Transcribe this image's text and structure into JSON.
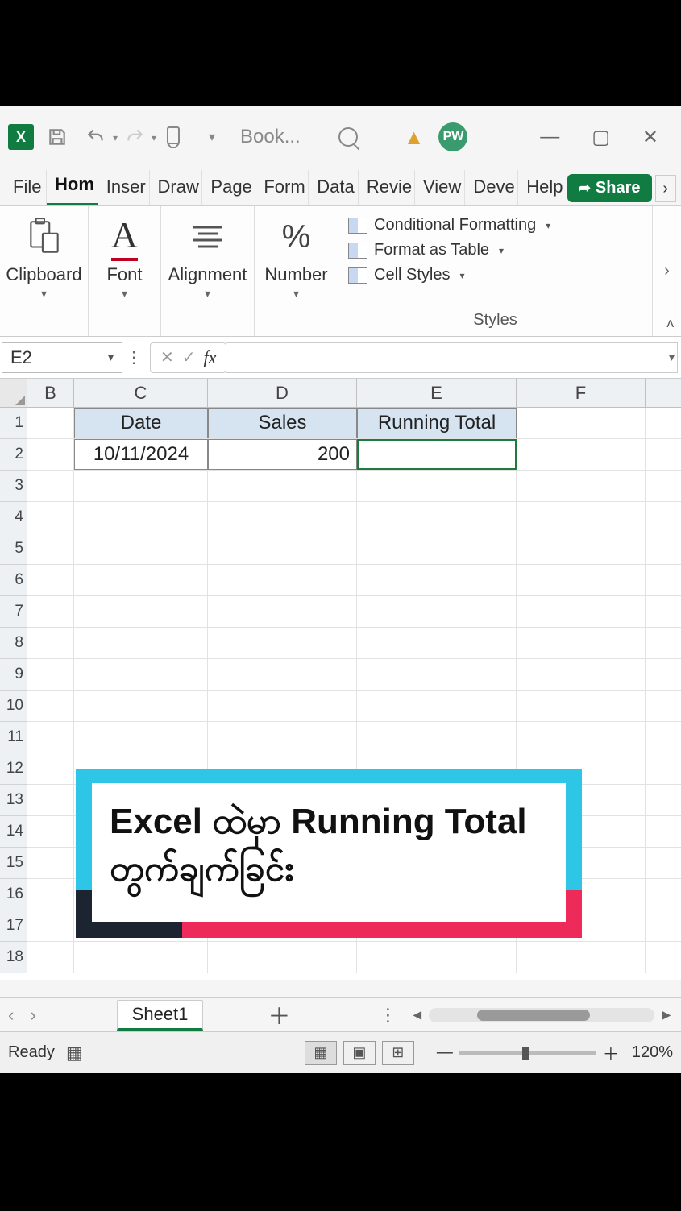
{
  "titlebar": {
    "doc_name": "Book...",
    "avatar_initials": "PW"
  },
  "tabs": {
    "file": "File",
    "home": "Hom",
    "insert": "Inser",
    "draw": "Draw",
    "page": "Page",
    "form": "Form",
    "data": "Data",
    "review": "Revie",
    "view": "View",
    "deve": "Deve",
    "help": "Help",
    "share": "Share"
  },
  "ribbon": {
    "clipboard": "Clipboard",
    "font": "Font",
    "alignment": "Alignment",
    "number": "Number",
    "cond_fmt": "Conditional Formatting",
    "fmt_table": "Format as Table",
    "cell_styles": "Cell Styles",
    "styles_label": "Styles"
  },
  "namebox": "E2",
  "fx_label": "fx",
  "columns": {
    "B": "B",
    "C": "C",
    "D": "D",
    "E": "E",
    "F": "F"
  },
  "rows": [
    "1",
    "2",
    "3",
    "4",
    "5",
    "6",
    "7",
    "8",
    "9",
    "10",
    "11",
    "12",
    "13",
    "14",
    "15",
    "16",
    "17",
    "18"
  ],
  "sheet": {
    "headers": {
      "date": "Date",
      "sales": "Sales",
      "running_total": "Running Total"
    },
    "row2": {
      "date": "10/11/2024",
      "sales": "200"
    }
  },
  "caption": "Excel ထဲမှာ Running Total တွက်ချက်ခြင်း",
  "sheet_tab": "Sheet1",
  "status": {
    "ready": "Ready",
    "zoom": "120%"
  }
}
